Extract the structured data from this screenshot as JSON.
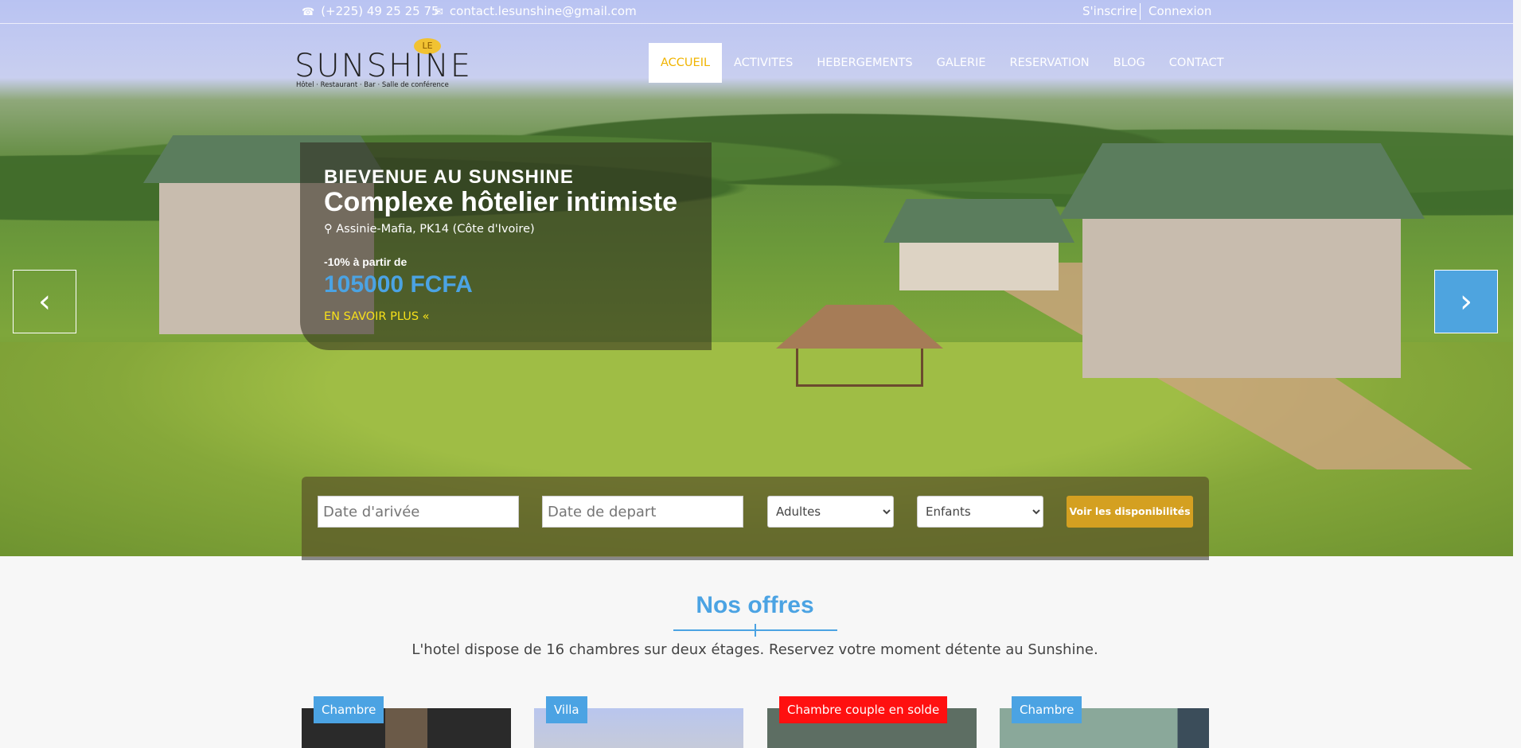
{
  "topbar": {
    "phone": "(+225) 49 25 25 75",
    "email": "contact.lesunshine@gmail.com",
    "signup": "S'inscrire",
    "login": "Connexion"
  },
  "logo": {
    "badge": "LE",
    "name": "SUNSHINE",
    "tagline": "Hôtel · Restaurant · Bar · Salle de conférence"
  },
  "nav": {
    "items": [
      "ACCUEIL",
      "ACTIVITES",
      "HEBERGEMENTS",
      "GALERIE",
      "RESERVATION",
      "BLOG",
      "CONTACT"
    ],
    "active": "ACCUEIL"
  },
  "hero": {
    "kicker": "BIEVENUE AU SUNSHINE",
    "headline": "Complexe hôtelier intimiste",
    "location": "Assinie-Mafia, PK14 (Côte d'Ivoire)",
    "promo": "-10% à partir de",
    "price": "105000 FCFA",
    "more": "EN SAVOIR PLUS «"
  },
  "carousel": {
    "prev": "‹",
    "next": "›"
  },
  "booking": {
    "arrival_placeholder": "Date d'arivée",
    "departure_placeholder": "Date de depart",
    "adults": "Adultes",
    "children": "Enfants",
    "submit": "Voir les disponibilités"
  },
  "offers": {
    "title": "Nos offres",
    "description": "L'hotel dispose de 16 chambres sur deux étages. Reservez votre moment détente au Sunshine.",
    "cards": [
      {
        "badge": "Chambre"
      },
      {
        "badge": "Villa"
      },
      {
        "badge": "Chambre couple en solde"
      },
      {
        "badge": "Chambre"
      }
    ]
  },
  "colors": {
    "accent": "#4ba3e3",
    "gold": "#d4a021",
    "active_nav": "#f0b400",
    "sale": "#ff1010"
  }
}
